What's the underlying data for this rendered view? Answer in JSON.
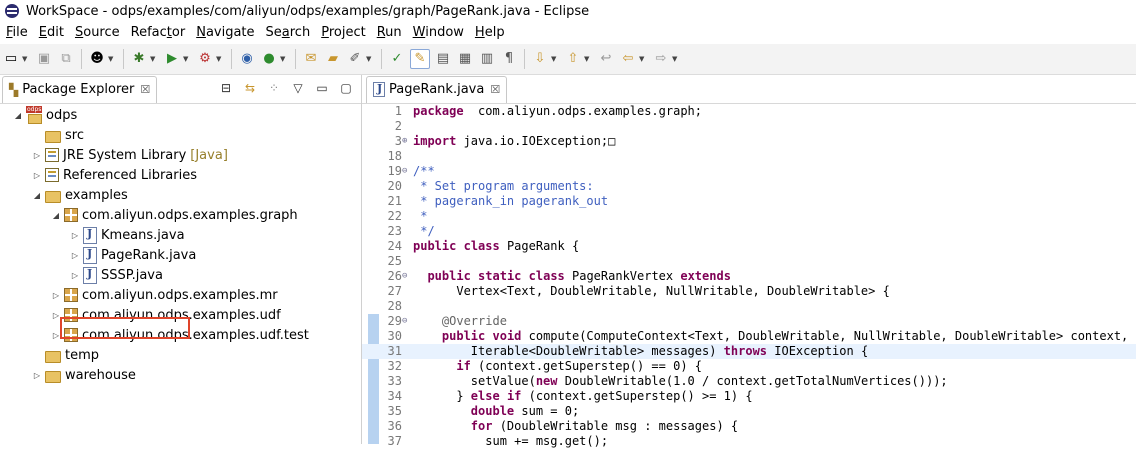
{
  "window": {
    "title": "WorkSpace - odps/examples/com/aliyun/odps/examples/graph/PageRank.java - Eclipse"
  },
  "menu": [
    {
      "u": "F",
      "rest": "ile"
    },
    {
      "u": "E",
      "rest": "dit"
    },
    {
      "u": "S",
      "rest": "ource"
    },
    {
      "pre": "Refac",
      "u": "t",
      "rest": "or"
    },
    {
      "u": "N",
      "rest": "avigate"
    },
    {
      "pre": "Se",
      "u": "a",
      "rest": "rch"
    },
    {
      "u": "P",
      "rest": "roject"
    },
    {
      "u": "R",
      "rest": "un"
    },
    {
      "u": "W",
      "rest": "indow"
    },
    {
      "u": "H",
      "rest": "elp"
    }
  ],
  "package_explorer": {
    "title": "Package Explorer",
    "close": "☒",
    "items": [
      {
        "label": "odps",
        "depth": 0,
        "twisty": "◢",
        "icon": "project"
      },
      {
        "label": "src",
        "depth": 1,
        "twisty": "",
        "icon": "folder"
      },
      {
        "label": "JRE System Library",
        "suffix": "[Java]",
        "depth": 1,
        "twisty": "▷",
        "icon": "library"
      },
      {
        "label": "Referenced Libraries",
        "depth": 1,
        "twisty": "▷",
        "icon": "library"
      },
      {
        "label": "examples",
        "depth": 1,
        "twisty": "◢",
        "icon": "folder"
      },
      {
        "label": "com.aliyun.odps.examples.graph",
        "depth": 2,
        "twisty": "◢",
        "icon": "package"
      },
      {
        "label": "Kmeans.java",
        "depth": 3,
        "twisty": "▷",
        "icon": "java"
      },
      {
        "label": "PageRank.java",
        "depth": 3,
        "twisty": "▷",
        "icon": "java"
      },
      {
        "label": "SSSP.java",
        "depth": 3,
        "twisty": "▷",
        "icon": "java"
      },
      {
        "label": "com.aliyun.odps.examples.mr",
        "depth": 2,
        "twisty": "▷",
        "icon": "package"
      },
      {
        "label": "com.aliyun.odps.examples.udf",
        "depth": 2,
        "twisty": "▷",
        "icon": "package"
      },
      {
        "label": "com.aliyun.odps.examples.udf.test",
        "depth": 2,
        "twisty": "▷",
        "icon": "package"
      },
      {
        "label": "temp",
        "depth": 1,
        "twisty": "",
        "icon": "folder"
      },
      {
        "label": "warehouse",
        "depth": 1,
        "twisty": "▷",
        "icon": "folder"
      }
    ]
  },
  "editor": {
    "tab_label": "PageRank.java",
    "close": "☒",
    "lines": [
      {
        "n": "1",
        "fold": "",
        "segs": [
          [
            "kw",
            "package"
          ],
          [
            "",
            "  com.aliyun.odps.examples.graph;"
          ]
        ]
      },
      {
        "n": "2",
        "fold": "",
        "segs": []
      },
      {
        "n": "3",
        "fold": "⊕",
        "segs": [
          [
            "kw",
            "import"
          ],
          [
            "",
            " java.io.IOException;"
          ],
          [
            "",
            "□"
          ]
        ]
      },
      {
        "n": "18",
        "fold": "",
        "segs": []
      },
      {
        "n": "19",
        "fold": "⊖",
        "segs": [
          [
            "cm",
            "/**"
          ]
        ]
      },
      {
        "n": "20",
        "fold": "",
        "segs": [
          [
            "cm",
            " * Set program arguments:"
          ]
        ]
      },
      {
        "n": "21",
        "fold": "",
        "segs": [
          [
            "cm",
            " * pagerank_in pagerank_out"
          ]
        ]
      },
      {
        "n": "22",
        "fold": "",
        "segs": [
          [
            "cm",
            " *"
          ]
        ]
      },
      {
        "n": "23",
        "fold": "",
        "segs": [
          [
            "cm",
            " */"
          ]
        ]
      },
      {
        "n": "24",
        "fold": "",
        "segs": [
          [
            "kw",
            "public"
          ],
          [
            "",
            " "
          ],
          [
            "kw",
            "class"
          ],
          [
            "",
            " PageRank {"
          ]
        ]
      },
      {
        "n": "25",
        "fold": "",
        "segs": []
      },
      {
        "n": "26",
        "fold": "⊖",
        "segs": [
          [
            "",
            "  "
          ],
          [
            "kw",
            "public"
          ],
          [
            "",
            " "
          ],
          [
            "kw",
            "static"
          ],
          [
            "",
            " "
          ],
          [
            "kw",
            "class"
          ],
          [
            "",
            " PageRankVertex "
          ],
          [
            "kw",
            "extends"
          ]
        ]
      },
      {
        "n": "27",
        "fold": "",
        "segs": [
          [
            "",
            "      Vertex<Text, DoubleWritable, NullWritable, DoubleWritable> {"
          ]
        ]
      },
      {
        "n": "28",
        "fold": "",
        "segs": []
      },
      {
        "n": "29",
        "fold": "⊖",
        "segs": [
          [
            "",
            "    "
          ],
          [
            "an",
            "@Override"
          ]
        ]
      },
      {
        "n": "30",
        "fold": "",
        "segs": [
          [
            "",
            "    "
          ],
          [
            "kw",
            "public"
          ],
          [
            "",
            " "
          ],
          [
            "kw",
            "void"
          ],
          [
            "",
            " compute(ComputeContext<Text, DoubleWritable, NullWritable, DoubleWritable> context,"
          ]
        ]
      },
      {
        "n": "31",
        "fold": "",
        "current": true,
        "segs": [
          [
            "",
            "        Iterable<DoubleWritable> messages) "
          ],
          [
            "kw",
            "throws"
          ],
          [
            "",
            " IOException {"
          ]
        ]
      },
      {
        "n": "32",
        "fold": "",
        "segs": [
          [
            "",
            "      "
          ],
          [
            "kw",
            "if"
          ],
          [
            "",
            " (context.getSuperstep() == 0) {"
          ]
        ]
      },
      {
        "n": "33",
        "fold": "",
        "segs": [
          [
            "",
            "        setValue("
          ],
          [
            "kw",
            "new"
          ],
          [
            "",
            " DoubleWritable(1.0 / context.getTotalNumVertices()));"
          ]
        ]
      },
      {
        "n": "34",
        "fold": "",
        "segs": [
          [
            "",
            "      } "
          ],
          [
            "kw",
            "else"
          ],
          [
            "",
            " "
          ],
          [
            "kw",
            "if"
          ],
          [
            "",
            " (context.getSuperstep() >= 1) {"
          ]
        ]
      },
      {
        "n": "35",
        "fold": "",
        "segs": [
          [
            "",
            "        "
          ],
          [
            "kw",
            "double"
          ],
          [
            "",
            " sum = 0;"
          ]
        ]
      },
      {
        "n": "36",
        "fold": "",
        "segs": [
          [
            "",
            "        "
          ],
          [
            "kw",
            "for"
          ],
          [
            "",
            " (DoubleWritable msg : messages) {"
          ]
        ]
      },
      {
        "n": "37",
        "fold": "",
        "segs": [
          [
            "",
            "          sum += msg.get();"
          ]
        ]
      }
    ]
  }
}
